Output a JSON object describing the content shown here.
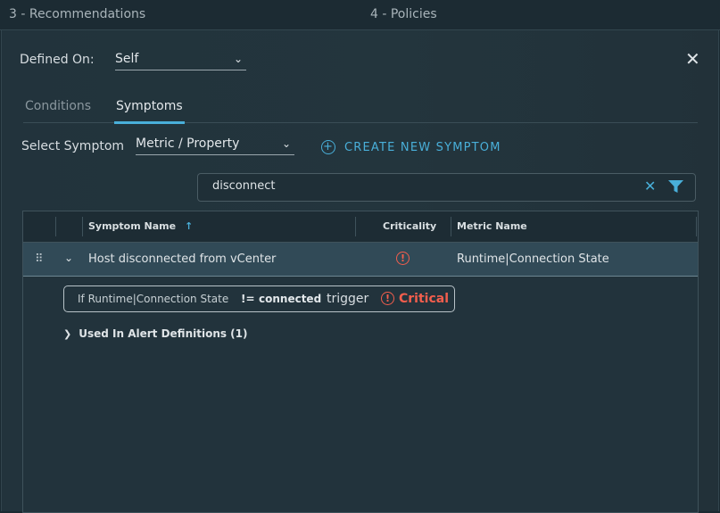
{
  "steps": [
    "3 - Recommendations",
    "4 - Policies"
  ],
  "defined_on": {
    "label": "Defined On:",
    "value": "Self"
  },
  "tabs": [
    {
      "label": "Conditions",
      "active": false
    },
    {
      "label": "Symptoms",
      "active": true
    }
  ],
  "select_symptom": {
    "label": "Select Symptom",
    "value": "Metric / Property"
  },
  "create_button": "CREATE NEW SYMPTOM",
  "search": {
    "value": "disconnect"
  },
  "grid": {
    "columns": [
      "Symptom Name",
      "Criticality",
      "Metric Name"
    ],
    "sort_indicator": "↑",
    "rows": [
      {
        "symptom_name": "Host disconnected from vCenter",
        "criticality_icon": "critical-icon",
        "metric_name": "Runtime|Connection State"
      }
    ]
  },
  "condition": {
    "prefix": "If Runtime|Connection State",
    "operator": "!=",
    "value": "connected",
    "trigger": "trigger",
    "severity": "Critical"
  },
  "used_in": "Used In Alert Definitions (1)",
  "colors": {
    "accent": "#49afd9",
    "critical": "#f35e4d",
    "selected_row": "#314a57"
  }
}
